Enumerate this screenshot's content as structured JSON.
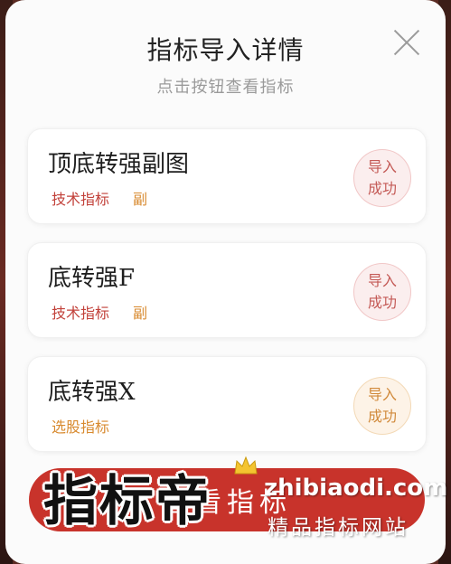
{
  "modal": {
    "title": "指标导入详情",
    "subtitle": "点击按钮查看指标"
  },
  "cards": [
    {
      "name": "顶底转强副图",
      "tags": [
        "技术指标",
        "副"
      ],
      "status_line1": "导入",
      "status_line2": "成功"
    },
    {
      "name": "底转强F",
      "tags": [
        "技术指标",
        "副"
      ],
      "status_line1": "导入",
      "status_line2": "成功"
    },
    {
      "name": "底转强X",
      "tags": [
        "选股指标"
      ],
      "status_line1": "导入",
      "status_line2": "成功"
    }
  ],
  "bottom_button": {
    "label": "查看指标"
  },
  "watermark": {
    "brand": "指标帝",
    "url": "zhibiaodi.com",
    "slogan": "精品指标网站"
  },
  "colors": {
    "accent_red": "#c8332b",
    "tag_red": "#c2413a",
    "tag_orange": "#d88a2f"
  },
  "icons": [
    "close-icon",
    "crown-icon"
  ]
}
